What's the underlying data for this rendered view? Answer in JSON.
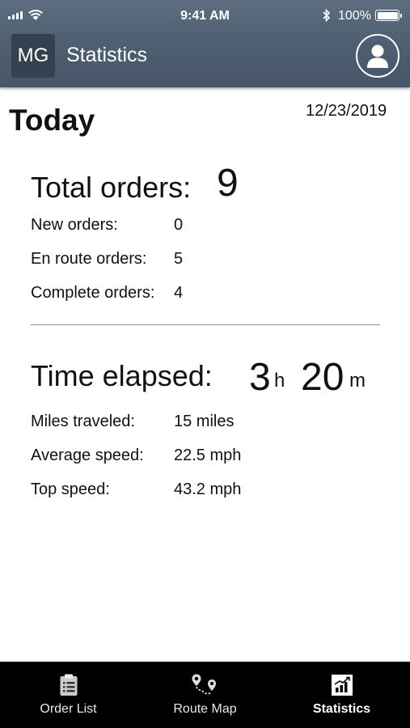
{
  "status_bar": {
    "time": "9:41 AM",
    "battery": "100%"
  },
  "header": {
    "app_icon_text": "MG",
    "title": "Statistics"
  },
  "today": {
    "heading": "Today",
    "date": "12/23/2019"
  },
  "orders": {
    "total_label": "Total orders:",
    "total_value": "9",
    "rows": [
      {
        "label": "New orders:",
        "value": "0"
      },
      {
        "label": "En route orders:",
        "value": "5"
      },
      {
        "label": "Complete orders:",
        "value": "4"
      }
    ]
  },
  "time": {
    "label": "Time elapsed:",
    "hours": "3",
    "hours_unit": "h",
    "minutes": "20",
    "minutes_unit": "m",
    "rows": [
      {
        "label": "Miles traveled:",
        "value": "15 miles"
      },
      {
        "label": "Average speed:",
        "value": "22.5 mph"
      },
      {
        "label": "Top speed:",
        "value": "43.2 mph"
      }
    ]
  },
  "tabs": [
    {
      "label": "Order List",
      "icon": "clipboard-icon",
      "active": false
    },
    {
      "label": "Route Map",
      "icon": "route-map-icon",
      "active": false
    },
    {
      "label": "Statistics",
      "icon": "statistics-chart-icon",
      "active": true
    }
  ],
  "colors": {
    "header": "#4f6073",
    "app_icon_bg": "#36414f",
    "tabbar": "#000000"
  }
}
